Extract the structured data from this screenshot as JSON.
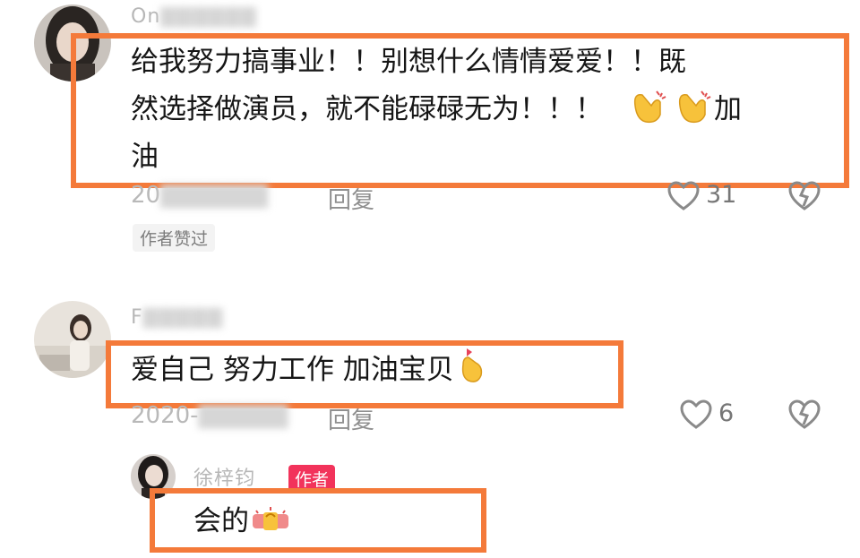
{
  "comments": [
    {
      "username": "On",
      "text_line1": "给我努力搞事业！！别想什么情情爱爱！！既",
      "text_line2": "然选择做演员，就不能碌碌无为！！！",
      "text_line2_tail": "加",
      "text_line3": "油",
      "date": "20",
      "reply_label": "回复",
      "likes": "31",
      "liked_badge": "作者赞过"
    },
    {
      "username": "F",
      "text": "爱自己 努力工作 加油宝贝",
      "date": "2020-",
      "reply_label": "回复",
      "likes": "6",
      "reply": {
        "username": "徐梓钧",
        "author_badge": "作者",
        "text": "会的"
      }
    }
  ],
  "colors": {
    "highlight": "#f47a3a",
    "author_badge": "#f2335b"
  },
  "icons": [
    "clapping-hands-icon",
    "finger-heart-icon",
    "gift-emoji-icon",
    "heart-outline-icon",
    "broken-heart-icon"
  ]
}
